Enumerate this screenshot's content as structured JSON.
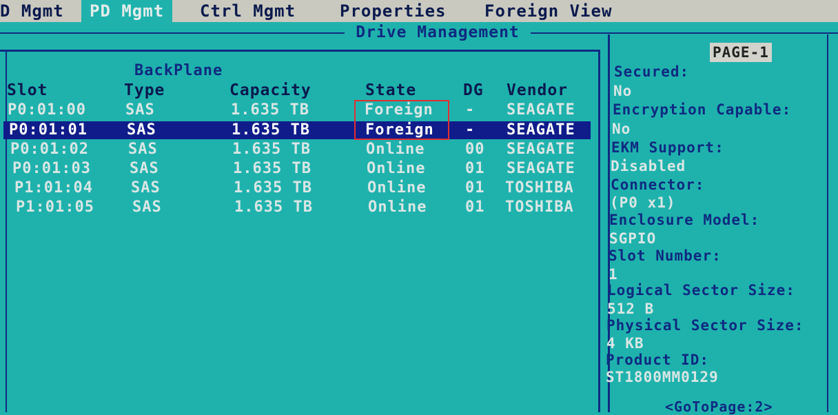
{
  "menu": {
    "items": [
      {
        "label": "D Mgmt"
      },
      {
        "label": "PD Mgmt"
      },
      {
        "label": "Ctrl Mgmt"
      },
      {
        "label": "Properties"
      },
      {
        "label": "Foreign View"
      }
    ],
    "active_index": 1
  },
  "panel": {
    "title": "Drive Management",
    "group_label": "BackPlane"
  },
  "table": {
    "headers": {
      "slot": "Slot",
      "type": "Type",
      "capacity": "Capacity",
      "state": "State",
      "dg": "DG",
      "vendor": "Vendor"
    },
    "rows": [
      {
        "slot": "P0:01:00",
        "type": "SAS",
        "capacity": "1.635 TB",
        "state": "Foreign",
        "dg": "-",
        "vendor": "SEAGATE"
      },
      {
        "slot": "P0:01:01",
        "type": "SAS",
        "capacity": "1.635 TB",
        "state": "Foreign",
        "dg": "-",
        "vendor": "SEAGATE"
      },
      {
        "slot": "P0:01:02",
        "type": "SAS",
        "capacity": "1.635 TB",
        "state": "Online",
        "dg": "00",
        "vendor": "SEAGATE"
      },
      {
        "slot": "P0:01:03",
        "type": "SAS",
        "capacity": "1.635 TB",
        "state": "Online",
        "dg": "01",
        "vendor": "SEAGATE"
      },
      {
        "slot": "P1:01:04",
        "type": "SAS",
        "capacity": "1.635 TB",
        "state": "Online",
        "dg": "01",
        "vendor": "TOSHIBA"
      },
      {
        "slot": "P1:01:05",
        "type": "SAS",
        "capacity": "1.635 TB",
        "state": "Online",
        "dg": "01",
        "vendor": "TOSHIBA"
      }
    ],
    "selected_index": 1
  },
  "info": {
    "page": "PAGE-1",
    "fields": [
      {
        "label": "Secured:",
        "value": "No"
      },
      {
        "label": "Encryption Capable:",
        "value": "No"
      },
      {
        "label": "EKM Support:",
        "value": "Disabled"
      },
      {
        "label": "Connector:",
        "value": "(P0 x1)"
      },
      {
        "label": "Enclosure Model:",
        "value": "SGPIO"
      },
      {
        "label": "Slot Number:",
        "value": "1"
      },
      {
        "label": "Logical Sector Size:",
        "value": "512 B"
      },
      {
        "label": "Physical Sector Size:",
        "value": "4 KB"
      },
      {
        "label": "Product ID:",
        "value": "ST1800MM0129"
      }
    ],
    "goto_page": "<GoToPage:2>"
  },
  "colors": {
    "background": "#1fb2ad",
    "frame": "#0f2a80",
    "selected_row": "#101c8a",
    "highlight_box": "#e03030",
    "menubar": "#c9c9bf"
  }
}
